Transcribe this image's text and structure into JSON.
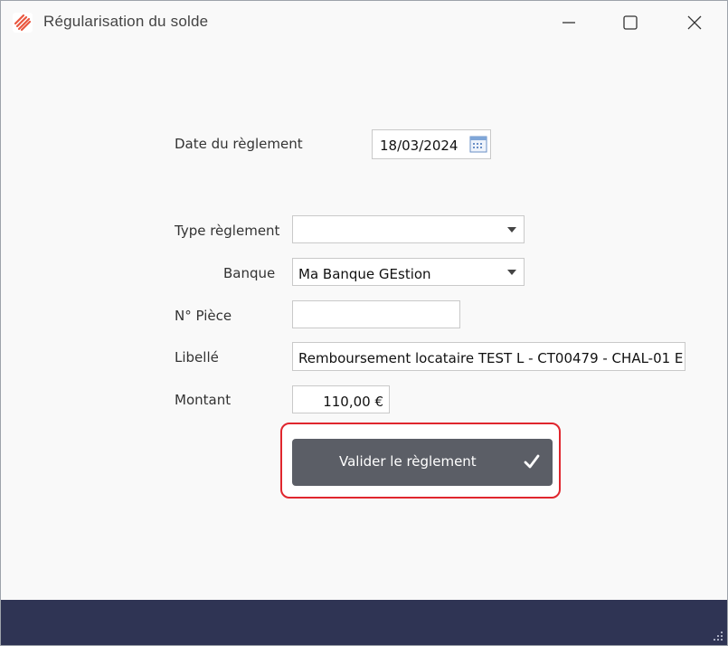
{
  "window": {
    "title": "Régularisation du solde"
  },
  "form": {
    "date_label": "Date du règlement",
    "date_value": "18/03/2024",
    "type_label": "Type règlement",
    "type_value": "",
    "bank_label": "Banque",
    "bank_value": "Ma Banque GEstion",
    "piece_label": "N° Pièce",
    "piece_value": "",
    "libelle_label": "Libellé",
    "libelle_value": "Remboursement locataire TEST L - CT00479 - CHAL-01 E",
    "amount_label": "Montant",
    "amount_value": "110,00 €"
  },
  "actions": {
    "validate_label": "Valider le règlement"
  },
  "colors": {
    "button_bg": "#5b5e66",
    "highlight": "#e0262e",
    "footer": "#2f3454"
  }
}
